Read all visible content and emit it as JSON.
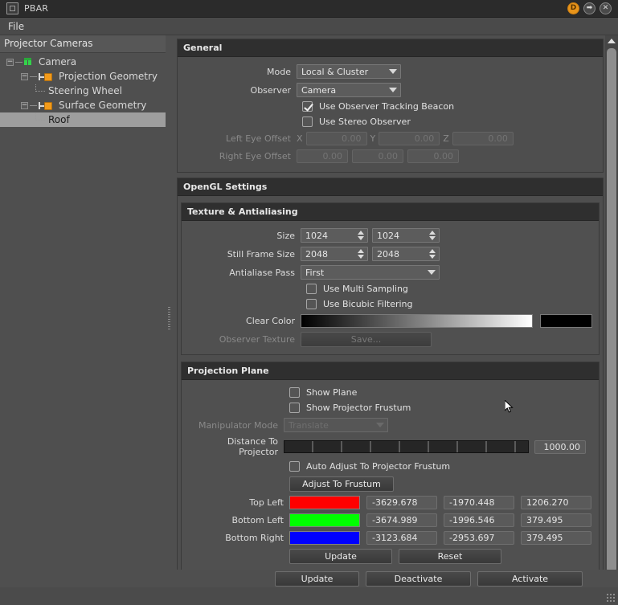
{
  "window": {
    "title": "PBAR",
    "app_icon": "window-icon",
    "buttons": [
      {
        "name": "dock-button",
        "label": "D"
      },
      {
        "name": "detach-button",
        "label": "➡"
      },
      {
        "name": "close-button",
        "label": "✕"
      }
    ]
  },
  "menubar": {
    "items": [
      {
        "label": "File"
      }
    ]
  },
  "tree_panel": {
    "header": "Projector Cameras",
    "nodes": [
      {
        "label": "Camera",
        "level": 0,
        "expander": "-",
        "icon": "camera-icon",
        "selected": false
      },
      {
        "label": "Projection Geometry",
        "level": 1,
        "expander": "-",
        "icon": "geometry-icon",
        "selected": false
      },
      {
        "label": "Steering Wheel",
        "level": 2,
        "expander": "",
        "icon": "leaf-icon",
        "selected": false
      },
      {
        "label": "Surface Geometry",
        "level": 1,
        "expander": "-",
        "icon": "geometry-icon",
        "selected": false
      },
      {
        "label": "Roof",
        "level": 2,
        "expander": "",
        "icon": "leaf-icon",
        "selected": true
      }
    ]
  },
  "general": {
    "title": "General",
    "mode_label": "Mode",
    "mode_value": "Local & Cluster",
    "observer_label": "Observer",
    "observer_value": "Camera",
    "use_tracking_beacon_label": "Use Observer Tracking Beacon",
    "use_tracking_beacon_checked": true,
    "use_stereo_observer_label": "Use Stereo Observer",
    "use_stereo_observer_checked": false,
    "left_eye_offset_label": "Left Eye Offset",
    "left_axis_x": "X",
    "left_axis_y": "Y",
    "left_axis_z": "Z",
    "left_eye_x": "0.00",
    "left_eye_y": "0.00",
    "left_eye_z": "0.00",
    "right_eye_offset_label": "Right Eye Offset",
    "right_eye_x": "0.00",
    "right_eye_y": "0.00",
    "right_eye_z": "0.00"
  },
  "opengl": {
    "title": "OpenGL Settings",
    "texture": {
      "title": "Texture & Antialiasing",
      "size_label": "Size",
      "size_w": "1024",
      "size_h": "1024",
      "still_label": "Still Frame Size",
      "still_w": "2048",
      "still_h": "2048",
      "antialiase_label": "Antialiase Pass",
      "antialiase_value": "First",
      "multi_sampling_label": "Use Multi Sampling",
      "multi_sampling_checked": false,
      "bicubic_label": "Use Bicubic Filtering",
      "bicubic_checked": false,
      "clear_color_label": "Clear Color",
      "clear_color_swatch": "#000000",
      "observer_texture_label": "Observer Texture",
      "observer_texture_button": "Save..."
    },
    "projection_plane": {
      "title": "Projection Plane",
      "show_plane_label": "Show Plane",
      "show_plane_checked": false,
      "show_frustum_label": "Show Projector Frustum",
      "show_frustum_checked": false,
      "manipulator_label": "Manipulator Mode",
      "manipulator_value": "Translate",
      "distance_label": "Distance To Projector",
      "distance_value": "1000.00",
      "auto_adjust_label": "Auto Adjust To Projector Frustum",
      "auto_adjust_checked": false,
      "adjust_button": "Adjust To Frustum",
      "corners": [
        {
          "label": "Top Left",
          "color": "#ff0000",
          "x": "-3629.678",
          "y": "-1970.448",
          "z": "1206.270"
        },
        {
          "label": "Bottom Left",
          "color": "#00ff00",
          "x": "-3674.989",
          "y": "-1996.546",
          "z": "379.495"
        },
        {
          "label": "Bottom Right",
          "color": "#0000ff",
          "x": "-3123.684",
          "y": "-2953.697",
          "z": "379.495"
        }
      ],
      "update_button": "Update",
      "reset_button": "Reset"
    }
  },
  "footer": {
    "update_button": "Update",
    "deactivate_button": "Deactivate",
    "activate_button": "Activate"
  }
}
